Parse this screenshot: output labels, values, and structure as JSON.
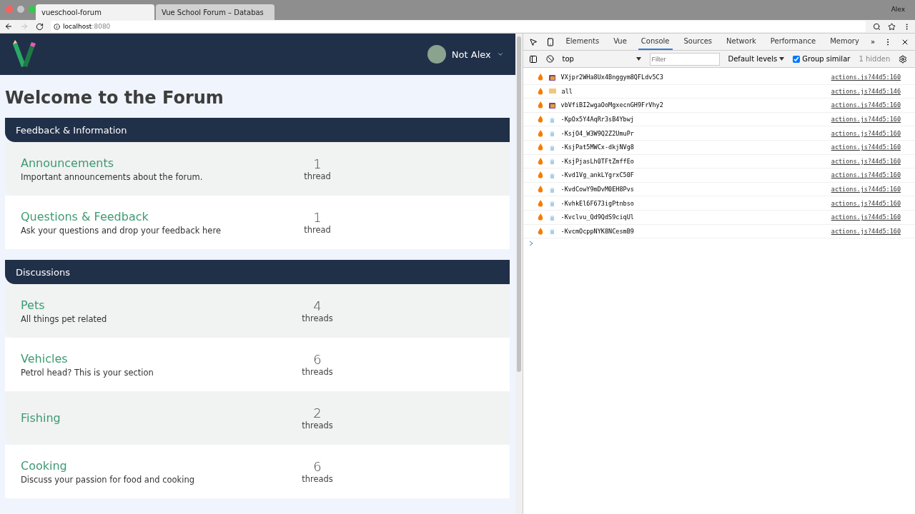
{
  "browser": {
    "tabs": [
      {
        "title": "vueschool-forum",
        "selected": true
      },
      {
        "title": "Vue School Forum – Databas",
        "selected": false
      }
    ],
    "profile": "Alex",
    "address": {
      "host": "localhost",
      "port": ":8080"
    }
  },
  "app": {
    "user": "Not Alex",
    "title": "Welcome to the Forum",
    "categories": [
      {
        "name": "Feedback & Information",
        "forums": [
          {
            "name": "Announcements",
            "description": "Important announcements about the forum.",
            "count": "1",
            "unit": "thread"
          },
          {
            "name": "Questions & Feedback",
            "description": "Ask your questions and drop your feedback here",
            "count": "1",
            "unit": "thread"
          }
        ]
      },
      {
        "name": "Discussions",
        "forums": [
          {
            "name": "Pets",
            "description": "All things pet related",
            "count": "4",
            "unit": "threads"
          },
          {
            "name": "Vehicles",
            "description": "Petrol head? This is your section",
            "count": "6",
            "unit": "threads"
          },
          {
            "name": "Fishing",
            "count": "2",
            "unit": "threads"
          },
          {
            "name": "Cooking",
            "description": "Discuss your passion for food and cooking",
            "count": "6",
            "unit": "threads"
          }
        ]
      }
    ]
  },
  "devtools": {
    "tabs": [
      {
        "label": "Elements",
        "selected": false
      },
      {
        "label": "Vue",
        "selected": false
      },
      {
        "label": "Console",
        "selected": true
      },
      {
        "label": "Sources",
        "selected": false
      },
      {
        "label": "Network",
        "selected": false
      },
      {
        "label": "Performance",
        "selected": false
      },
      {
        "label": "Memory",
        "selected": false
      }
    ],
    "more": "»",
    "context": "top",
    "filter_placeholder": "Filter",
    "levels": "Default levels",
    "group_similar": {
      "label": "Group similar",
      "checked": true
    },
    "hidden": "1 hidden",
    "messages": [
      {
        "kind": "object",
        "text": "VXjpr2WHa8Ux4Bnggym8QFLdv5C3",
        "source": "actions.js?44d5:160"
      },
      {
        "kind": "tag",
        "text": "all",
        "source": "actions.js?44d5:146"
      },
      {
        "kind": "object",
        "text": "vbVfiBI2wgaOoMgxecnGH9FrVhy2",
        "source": "actions.js?44d5:160"
      },
      {
        "kind": "cup",
        "text": "-KpOx5Y4AqRr3sB4Ybwj",
        "source": "actions.js?44d5:160"
      },
      {
        "kind": "cup",
        "text": "-KsjO4_W3W9Q2Z2UmuPr",
        "source": "actions.js?44d5:160"
      },
      {
        "kind": "cup",
        "text": "-KsjPat5MWCx-dkjNVg8",
        "source": "actions.js?44d5:160"
      },
      {
        "kind": "cup",
        "text": "-KsjPjasLh0TFtZmffEo",
        "source": "actions.js?44d5:160"
      },
      {
        "kind": "cup",
        "text": "-Kvd1Vg_ankLYgrxC50F",
        "source": "actions.js?44d5:160"
      },
      {
        "kind": "cup",
        "text": "-KvdCowY9mDvM0EH8Pvs",
        "source": "actions.js?44d5:160"
      },
      {
        "kind": "cup",
        "text": "-KvhkEl6F673igPtnbso",
        "source": "actions.js?44d5:160"
      },
      {
        "kind": "cup",
        "text": "-Kvclvu_Qd9QdS9ciqUl",
        "source": "actions.js?44d5:160"
      },
      {
        "kind": "cup",
        "text": "-KvcmOcppNYK8NCesmB9",
        "source": "actions.js?44d5:160"
      }
    ]
  }
}
